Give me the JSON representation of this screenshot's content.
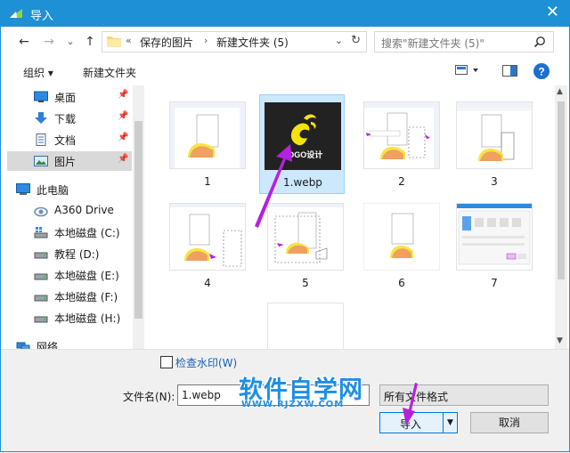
{
  "window": {
    "title": "导入",
    "close_glyph": "✕",
    "accent": "#1e90d6"
  },
  "nav": {
    "back_glyph": "←",
    "forward_glyph": "→",
    "history_glyph": "⌄",
    "up_glyph": "↑",
    "breadcrumb": {
      "overflow": "«",
      "items": [
        "保存的图片",
        "新建文件夹 (5)"
      ],
      "separator": "›"
    },
    "dropdown_glyph": "⌄",
    "refresh_glyph": "↻",
    "search_placeholder": "搜索\"新建文件夹 (5)\""
  },
  "toolbar": {
    "organize": "组织 ▾",
    "new_folder": "新建文件夹",
    "help_glyph": "?"
  },
  "sidebar": {
    "items": [
      {
        "label": "桌面",
        "icon": "desktop-icon",
        "pinned": true
      },
      {
        "label": "下载",
        "icon": "download-icon",
        "pinned": true
      },
      {
        "label": "文档",
        "icon": "document-icon",
        "pinned": true
      },
      {
        "label": "图片",
        "icon": "pictures-icon",
        "pinned": true,
        "selected": true
      },
      {
        "label": "此电脑",
        "icon": "computer-icon",
        "pinned": false
      },
      {
        "label": "A360 Drive",
        "icon": "cloud-drive-icon",
        "pinned": false
      },
      {
        "label": "本地磁盘 (C:)",
        "icon": "windows-drive-icon",
        "pinned": false
      },
      {
        "label": "教程 (D:)",
        "icon": "drive-icon",
        "pinned": false
      },
      {
        "label": "本地磁盘 (E:)",
        "icon": "drive-icon",
        "pinned": false
      },
      {
        "label": "本地磁盘 (F:)",
        "icon": "drive-icon",
        "pinned": false
      },
      {
        "label": "本地磁盘 (H:)",
        "icon": "drive-icon",
        "pinned": false
      },
      {
        "label": "网络",
        "icon": "network-icon",
        "pinned": false
      }
    ],
    "pin_glyph": "📌"
  },
  "files": [
    {
      "name": "1",
      "kind": "drawing"
    },
    {
      "name": "1.webp",
      "kind": "logo",
      "selected": true,
      "logo_text": "LOGO设计"
    },
    {
      "name": "2",
      "kind": "drawing"
    },
    {
      "name": "3",
      "kind": "drawing"
    },
    {
      "name": "4",
      "kind": "drawing"
    },
    {
      "name": "5",
      "kind": "drawing"
    },
    {
      "name": "6",
      "kind": "drawing"
    },
    {
      "name": "7",
      "kind": "dialog"
    },
    {
      "name": "",
      "kind": "blank"
    }
  ],
  "bottom": {
    "watermark_checkbox": "检查水印(W)",
    "filename_label": "文件名(N):",
    "filename_value": "1.webp",
    "filetype_value": "所有文件格式",
    "import_button": "导入",
    "cancel_button": "取消"
  },
  "watermark": {
    "main": "软件自学网",
    "url": "WWW.RJZXW.COM"
  },
  "colors": {
    "selection": "#cce8ff",
    "annotation": "#b620e0",
    "shape_orange": "#f0a060",
    "shape_yellow": "#f5e642"
  }
}
